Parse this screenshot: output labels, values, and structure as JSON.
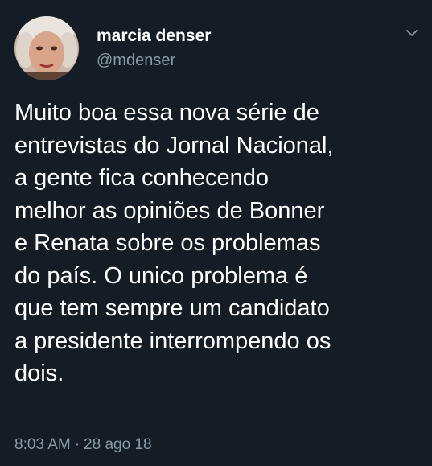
{
  "tweet": {
    "display_name": "marcia denser",
    "handle": "@mdenser",
    "avatar_icon": "profile-photo",
    "menu_icon": "chevron-down-icon",
    "text_lines": [
      "Muito boa essa nova série de",
      "entrevistas do Jornal Nacional,",
      "a gente fica conhecendo",
      "melhor as opiniões de Bonner",
      "e Renata sobre os problemas",
      "do país. O unico problema é",
      "que tem sempre um candidato",
      "a presidente interrompendo os",
      "dois."
    ],
    "time": "8:03 AM",
    "separator": "·",
    "date": "28 ago 18"
  },
  "colors": {
    "background": "#141d26",
    "text": "#ffffff",
    "secondary": "#8899a6"
  }
}
